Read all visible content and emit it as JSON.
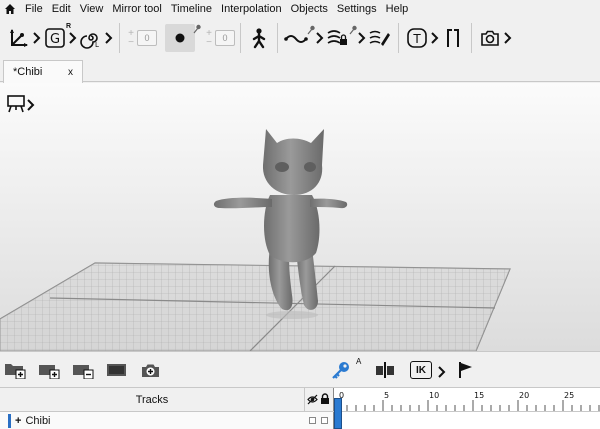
{
  "menu": {
    "home_icon": "home-icon",
    "items": [
      "File",
      "Edit",
      "View",
      "Mirror tool",
      "Timeline",
      "Interpolation",
      "Objects",
      "Settings",
      "Help"
    ]
  },
  "toolbar": {
    "bone_superscript": "R",
    "stepper1_value": "0",
    "stepper2_value": "0",
    "stepper_plus": "+",
    "stepper_minus": "−"
  },
  "tab": {
    "title": "*Chibi",
    "close": "x"
  },
  "timeline_toolbar": {
    "key_superscript": "A",
    "ik_label": "IK"
  },
  "tracks": {
    "header": "Tracks",
    "ruler_labels": [
      "0",
      "5",
      "10",
      "15",
      "20",
      "25"
    ],
    "rows": [
      {
        "expand": "+",
        "name": "Chibi"
      }
    ]
  },
  "colors": {
    "accent": "#2a7ad1",
    "key_blue": "#2a7ad1",
    "background": "#f0f0f0"
  }
}
